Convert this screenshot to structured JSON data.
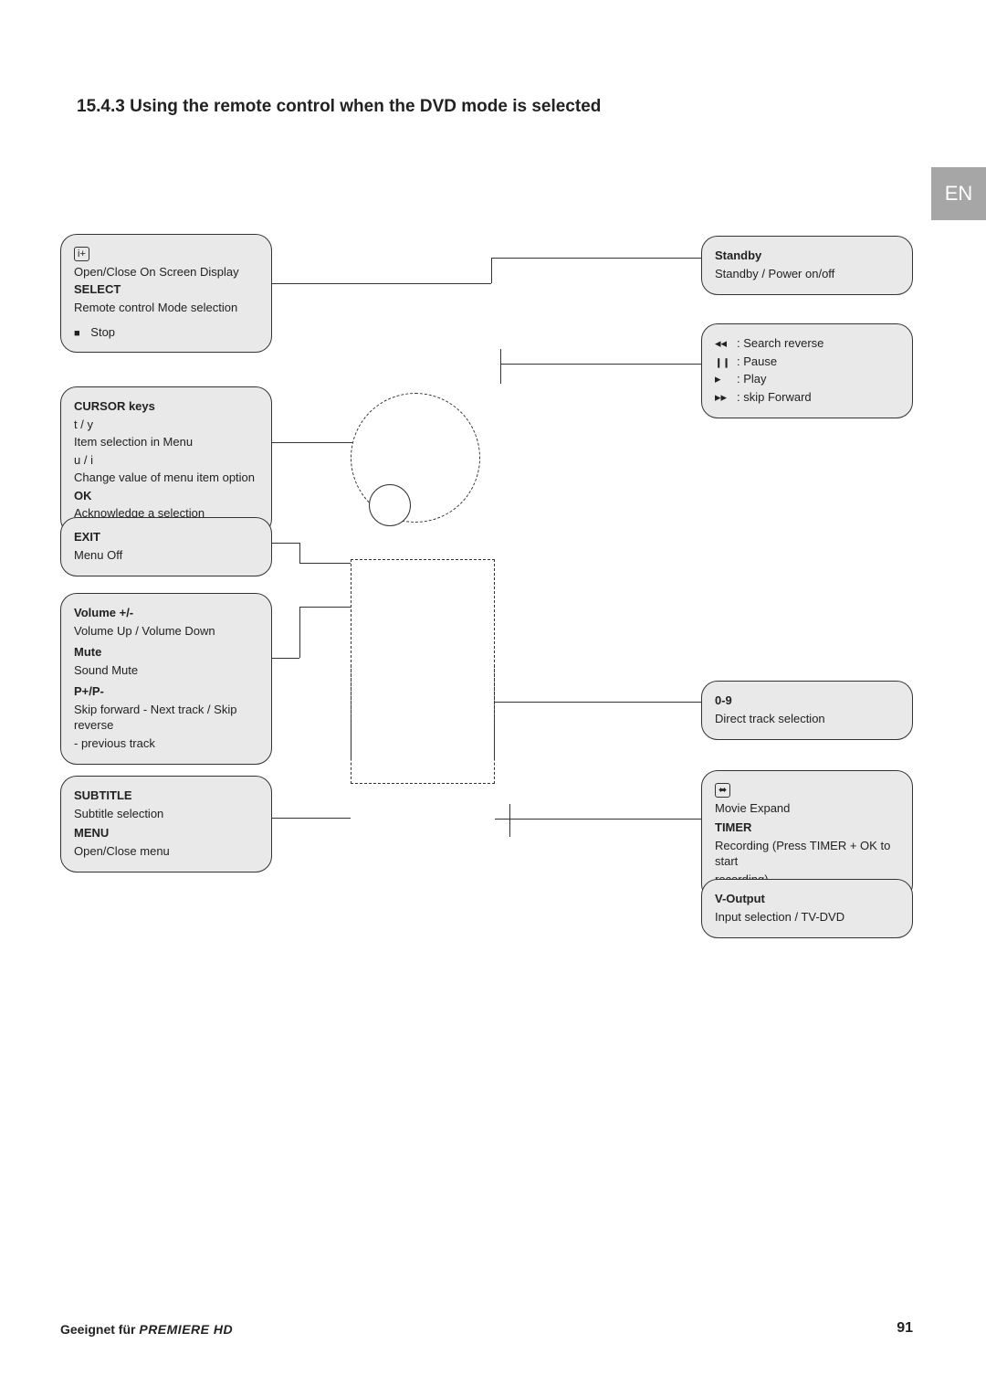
{
  "heading": "15.4.3 Using the remote control when the DVD mode is selected",
  "langTab": "EN",
  "left": {
    "osd": {
      "iconLabel": "i+",
      "line1": "Open/Close On Screen Display",
      "select_h": "SELECT",
      "select_d": "Remote control Mode selection",
      "stop_sym": "■",
      "stop_d": "Stop"
    },
    "cursor": {
      "h": "CURSOR keys",
      "l1": "t  / y",
      "l2": "Item selection in Menu",
      "l3": "u  /  i",
      "l4": "Change value of menu item option",
      "ok_h": "OK",
      "ok_d": "Acknowledge a selection"
    },
    "exit": {
      "h": "EXIT",
      "d": "Menu Off"
    },
    "vol": {
      "vol_h": "Volume       +/-",
      "vol_d": "Volume Up / Volume Down",
      "mute_h": "Mute",
      "mute_d": "Sound Mute",
      "p_h": "P+/P-",
      "p_d1": "Skip forward - Next track / Skip reverse",
      "p_d2": "- previous track"
    },
    "sub": {
      "sub_h": "SUBTITLE",
      "sub_d": "Subtitle selection",
      "menu_h": "MENU",
      "menu_d": "Open/Close menu"
    }
  },
  "right": {
    "standby": {
      "h": "Standby",
      "d": "Standby / Power on/off"
    },
    "playback": {
      "rev_sym": "◂◂",
      "rev_d": ": Search reverse",
      "pause_sym": "❙❙",
      "pause_d": ": Pause",
      "play_sym": "▸",
      "play_d": ": Play",
      "fwd_sym": "▸▸",
      "fwd_d": ": skip Forward"
    },
    "digits": {
      "h": "0-9",
      "d": "Direct track selection"
    },
    "movex": {
      "iconLabel": "⬌",
      "l1": "Movie Expand",
      "timer_h": "TIMER",
      "timer_d1": "Recording (Press TIMER + OK to start",
      "timer_d2": "recording)"
    },
    "vout": {
      "h": "V-Output",
      "d": "Input selection / TV-DVD"
    }
  },
  "footer": {
    "left_pre": "Geeignet für ",
    "brand": "PREMIERE HD",
    "pageNum": "91"
  }
}
